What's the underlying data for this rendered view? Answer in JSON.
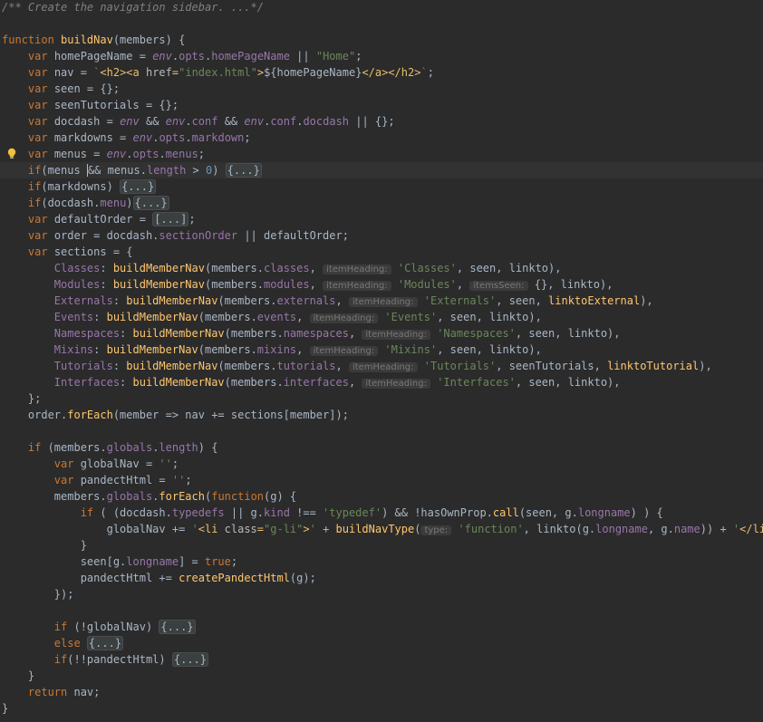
{
  "colors": {
    "background": "#2b2b2b",
    "keyword": "#cc7832",
    "string": "#6a8759",
    "number": "#6897bb",
    "comment": "#808080",
    "function": "#ffc66d",
    "property": "#9876aa",
    "text": "#a9b7c6"
  },
  "icons": {
    "intention_bulb": "lightbulb-icon"
  },
  "lines": [
    [
      [
        "cmt",
        "/** Create the navigation sidebar. ...*/"
      ]
    ],
    [],
    [
      [
        "kw",
        "function "
      ],
      [
        "fn",
        "buildNav"
      ],
      [
        "var",
        "(members) {"
      ]
    ],
    [
      [
        "var",
        "    "
      ],
      [
        "kw",
        "var "
      ],
      [
        "var",
        "homePageName = "
      ],
      [
        "global",
        "env"
      ],
      [
        "var",
        "."
      ],
      [
        "prop",
        "opts"
      ],
      [
        "var",
        "."
      ],
      [
        "prop",
        "homePageName"
      ],
      [
        "var",
        " || "
      ],
      [
        "str",
        "\"Home\""
      ],
      [
        "var",
        ";"
      ]
    ],
    [
      [
        "var",
        "    "
      ],
      [
        "kw",
        "var "
      ],
      [
        "var",
        "nav = "
      ],
      [
        "str",
        "`"
      ],
      [
        "html",
        "<h2><a "
      ],
      [
        "attr",
        "href"
      ],
      [
        "html",
        "="
      ],
      [
        "str",
        "\"index.html\""
      ],
      [
        "html",
        ">"
      ],
      [
        "var",
        "${homePageName}"
      ],
      [
        "html",
        "</a></h2>"
      ],
      [
        "str",
        "`"
      ],
      [
        "var",
        ";"
      ]
    ],
    [
      [
        "var",
        "    "
      ],
      [
        "kw",
        "var "
      ],
      [
        "var",
        "seen = {};"
      ]
    ],
    [
      [
        "var",
        "    "
      ],
      [
        "kw",
        "var "
      ],
      [
        "var",
        "seenTutorials = {};"
      ]
    ],
    [
      [
        "var",
        "    "
      ],
      [
        "kw",
        "var "
      ],
      [
        "var",
        "docdash = "
      ],
      [
        "global",
        "env"
      ],
      [
        "var",
        " && "
      ],
      [
        "global",
        "env"
      ],
      [
        "var",
        "."
      ],
      [
        "prop",
        "conf"
      ],
      [
        "var",
        " && "
      ],
      [
        "global",
        "env"
      ],
      [
        "var",
        "."
      ],
      [
        "prop",
        "conf"
      ],
      [
        "var",
        "."
      ],
      [
        "prop",
        "docdash"
      ],
      [
        "var",
        " || {};"
      ]
    ],
    [
      [
        "var",
        "    "
      ],
      [
        "kw",
        "var "
      ],
      [
        "var",
        "markdowns = "
      ],
      [
        "global",
        "env"
      ],
      [
        "var",
        "."
      ],
      [
        "prop",
        "opts"
      ],
      [
        "var",
        "."
      ],
      [
        "prop",
        "markdown"
      ],
      [
        "var",
        ";"
      ]
    ],
    [
      [
        "var",
        "    "
      ],
      [
        "kw",
        "var "
      ],
      [
        "var",
        "menus = "
      ],
      [
        "global",
        "env"
      ],
      [
        "var",
        "."
      ],
      [
        "prop",
        "opts"
      ],
      [
        "var",
        "."
      ],
      [
        "prop",
        "menus"
      ],
      [
        "var",
        ";"
      ]
    ],
    [
      [
        "var",
        "    "
      ],
      [
        "kw",
        "if"
      ],
      [
        "var",
        "(menus "
      ],
      [
        "caret",
        ""
      ],
      [
        "var",
        "&& menus."
      ],
      [
        "prop",
        "length"
      ],
      [
        "var",
        " > "
      ],
      [
        "num",
        "0"
      ],
      [
        "var",
        ") "
      ],
      [
        "fold",
        "{...}"
      ]
    ],
    [
      [
        "var",
        "    "
      ],
      [
        "kw",
        "if"
      ],
      [
        "var",
        "(markdowns) "
      ],
      [
        "fold",
        "{...}"
      ]
    ],
    [
      [
        "var",
        "    "
      ],
      [
        "kw",
        "if"
      ],
      [
        "var",
        "(docdash."
      ],
      [
        "prop",
        "menu"
      ],
      [
        "var",
        ")"
      ],
      [
        "fold",
        "{...}"
      ]
    ],
    [
      [
        "var",
        "    "
      ],
      [
        "kw",
        "var "
      ],
      [
        "var",
        "defaultOrder = "
      ],
      [
        "fold",
        "[...]"
      ],
      [
        "var",
        ";"
      ]
    ],
    [
      [
        "var",
        "    "
      ],
      [
        "kw",
        "var "
      ],
      [
        "var",
        "order = docdash."
      ],
      [
        "prop",
        "sectionOrder"
      ],
      [
        "var",
        " || defaultOrder;"
      ]
    ],
    [
      [
        "var",
        "    "
      ],
      [
        "kw",
        "var "
      ],
      [
        "var",
        "sections = {"
      ]
    ],
    [
      [
        "var",
        "        "
      ],
      [
        "prop",
        "Classes"
      ],
      [
        "var",
        ": "
      ],
      [
        "fn",
        "buildMemberNav"
      ],
      [
        "var",
        "(members."
      ],
      [
        "prop",
        "classes"
      ],
      [
        "var",
        ", "
      ],
      [
        "hint",
        "itemHeading:"
      ],
      [
        "var",
        " "
      ],
      [
        "str",
        "'Classes'"
      ],
      [
        "var",
        ", seen, linkto),"
      ]
    ],
    [
      [
        "var",
        "        "
      ],
      [
        "prop",
        "Modules"
      ],
      [
        "var",
        ": "
      ],
      [
        "fn",
        "buildMemberNav"
      ],
      [
        "var",
        "(members."
      ],
      [
        "prop",
        "modules"
      ],
      [
        "var",
        ", "
      ],
      [
        "hint",
        "itemHeading:"
      ],
      [
        "var",
        " "
      ],
      [
        "str",
        "'Modules'"
      ],
      [
        "var",
        ", "
      ],
      [
        "hint",
        "itemsSeen:"
      ],
      [
        "var",
        " {}, linkto),"
      ]
    ],
    [
      [
        "var",
        "        "
      ],
      [
        "prop",
        "Externals"
      ],
      [
        "var",
        ": "
      ],
      [
        "fn",
        "buildMemberNav"
      ],
      [
        "var",
        "(members."
      ],
      [
        "prop",
        "externals"
      ],
      [
        "var",
        ", "
      ],
      [
        "hint",
        "itemHeading:"
      ],
      [
        "var",
        " "
      ],
      [
        "str",
        "'Externals'"
      ],
      [
        "var",
        ", seen, "
      ],
      [
        "fn",
        "linktoExternal"
      ],
      [
        "var",
        "),"
      ]
    ],
    [
      [
        "var",
        "        "
      ],
      [
        "prop",
        "Events"
      ],
      [
        "var",
        ": "
      ],
      [
        "fn",
        "buildMemberNav"
      ],
      [
        "var",
        "(members."
      ],
      [
        "prop",
        "events"
      ],
      [
        "var",
        ", "
      ],
      [
        "hint",
        "itemHeading:"
      ],
      [
        "var",
        " "
      ],
      [
        "str",
        "'Events'"
      ],
      [
        "var",
        ", seen, linkto),"
      ]
    ],
    [
      [
        "var",
        "        "
      ],
      [
        "prop",
        "Namespaces"
      ],
      [
        "var",
        ": "
      ],
      [
        "fn",
        "buildMemberNav"
      ],
      [
        "var",
        "(members."
      ],
      [
        "prop",
        "namespaces"
      ],
      [
        "var",
        ", "
      ],
      [
        "hint",
        "itemHeading:"
      ],
      [
        "var",
        " "
      ],
      [
        "str",
        "'Namespaces'"
      ],
      [
        "var",
        ", seen, linkto),"
      ]
    ],
    [
      [
        "var",
        "        "
      ],
      [
        "prop",
        "Mixins"
      ],
      [
        "var",
        ": "
      ],
      [
        "fn",
        "buildMemberNav"
      ],
      [
        "var",
        "(members."
      ],
      [
        "prop",
        "mixins"
      ],
      [
        "var",
        ", "
      ],
      [
        "hint",
        "itemHeading:"
      ],
      [
        "var",
        " "
      ],
      [
        "str",
        "'Mixins'"
      ],
      [
        "var",
        ", seen, linkto),"
      ]
    ],
    [
      [
        "var",
        "        "
      ],
      [
        "prop",
        "Tutorials"
      ],
      [
        "var",
        ": "
      ],
      [
        "fn",
        "buildMemberNav"
      ],
      [
        "var",
        "(members."
      ],
      [
        "prop",
        "tutorials"
      ],
      [
        "var",
        ", "
      ],
      [
        "hint",
        "itemHeading:"
      ],
      [
        "var",
        " "
      ],
      [
        "str",
        "'Tutorials'"
      ],
      [
        "var",
        ", seenTutorials, "
      ],
      [
        "fn",
        "linktoTutorial"
      ],
      [
        "var",
        "),"
      ]
    ],
    [
      [
        "var",
        "        "
      ],
      [
        "prop",
        "Interfaces"
      ],
      [
        "var",
        ": "
      ],
      [
        "fn",
        "buildMemberNav"
      ],
      [
        "var",
        "(members."
      ],
      [
        "prop",
        "interfaces"
      ],
      [
        "var",
        ", "
      ],
      [
        "hint",
        "itemHeading:"
      ],
      [
        "var",
        " "
      ],
      [
        "str",
        "'Interfaces'"
      ],
      [
        "var",
        ", seen, linkto),"
      ]
    ],
    [
      [
        "var",
        "    };"
      ]
    ],
    [
      [
        "var",
        "    order."
      ],
      [
        "fn",
        "forEach"
      ],
      [
        "var",
        "(member => nav += sections[member]);"
      ]
    ],
    [],
    [
      [
        "var",
        "    "
      ],
      [
        "kw",
        "if"
      ],
      [
        "var",
        " (members."
      ],
      [
        "prop",
        "globals"
      ],
      [
        "var",
        "."
      ],
      [
        "prop",
        "length"
      ],
      [
        "var",
        ") {"
      ]
    ],
    [
      [
        "var",
        "        "
      ],
      [
        "kw",
        "var "
      ],
      [
        "var",
        "globalNav = "
      ],
      [
        "str",
        "''"
      ],
      [
        "var",
        ";"
      ]
    ],
    [
      [
        "var",
        "        "
      ],
      [
        "kw",
        "var "
      ],
      [
        "var",
        "pandectHtml = "
      ],
      [
        "str",
        "''"
      ],
      [
        "var",
        ";"
      ]
    ],
    [
      [
        "var",
        "        members."
      ],
      [
        "prop",
        "globals"
      ],
      [
        "var",
        "."
      ],
      [
        "fn",
        "forEach"
      ],
      [
        "var",
        "("
      ],
      [
        "kw",
        "function"
      ],
      [
        "var",
        "(g) {"
      ]
    ],
    [
      [
        "var",
        "            "
      ],
      [
        "kw",
        "if"
      ],
      [
        "var",
        " ( (docdash."
      ],
      [
        "prop",
        "typedefs"
      ],
      [
        "var",
        " || g."
      ],
      [
        "prop",
        "kind"
      ],
      [
        "var",
        " !== "
      ],
      [
        "str",
        "'typedef'"
      ],
      [
        "var",
        ") && !hasOwnProp."
      ],
      [
        "fn",
        "call"
      ],
      [
        "var",
        "(seen, g."
      ],
      [
        "prop",
        "longname"
      ],
      [
        "var",
        ") ) {"
      ]
    ],
    [
      [
        "var",
        "                globalNav += "
      ],
      [
        "str",
        "'"
      ],
      [
        "html",
        "<li "
      ],
      [
        "attr",
        "class"
      ],
      [
        "html",
        "="
      ],
      [
        "str",
        "\"g-li\""
      ],
      [
        "html",
        ">"
      ],
      [
        "str",
        "'"
      ],
      [
        "var",
        " + "
      ],
      [
        "fn",
        "buildNavType"
      ],
      [
        "var",
        "("
      ],
      [
        "hint",
        "type:"
      ],
      [
        "var",
        " "
      ],
      [
        "str",
        "'function'"
      ],
      [
        "var",
        ", linkto(g."
      ],
      [
        "prop",
        "longname"
      ],
      [
        "var",
        ", g."
      ],
      [
        "prop",
        "name"
      ],
      [
        "var",
        ")) + "
      ],
      [
        "str",
        "'"
      ],
      [
        "html",
        "</li>"
      ],
      [
        "str",
        "'"
      ],
      [
        "var",
        ";"
      ]
    ],
    [
      [
        "var",
        "            }"
      ]
    ],
    [
      [
        "var",
        "            seen[g."
      ],
      [
        "prop",
        "longname"
      ],
      [
        "var",
        "] = "
      ],
      [
        "kw",
        "true"
      ],
      [
        "var",
        ";"
      ]
    ],
    [
      [
        "var",
        "            pandectHtml += "
      ],
      [
        "fn",
        "createPandectHtml"
      ],
      [
        "var",
        "(g);"
      ]
    ],
    [
      [
        "var",
        "        });"
      ]
    ],
    [],
    [
      [
        "var",
        "        "
      ],
      [
        "kw",
        "if"
      ],
      [
        "var",
        " (!globalNav) "
      ],
      [
        "fold",
        "{...}"
      ]
    ],
    [
      [
        "var",
        "        "
      ],
      [
        "kw",
        "else "
      ],
      [
        "fold",
        "{...}"
      ]
    ],
    [
      [
        "var",
        "        "
      ],
      [
        "kw",
        "if"
      ],
      [
        "var",
        "(!!pandectHtml) "
      ],
      [
        "fold",
        "{...}"
      ]
    ],
    [
      [
        "var",
        "    }"
      ]
    ],
    [
      [
        "var",
        "    "
      ],
      [
        "kw",
        "return "
      ],
      [
        "var",
        "nav;"
      ]
    ],
    [
      [
        "var",
        "}"
      ]
    ]
  ]
}
